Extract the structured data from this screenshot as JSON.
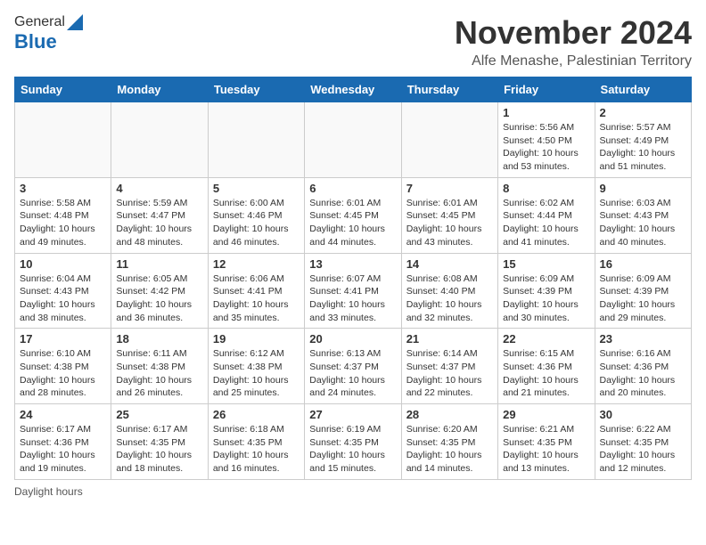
{
  "logo": {
    "general": "General",
    "blue": "Blue"
  },
  "header": {
    "month": "November 2024",
    "location": "Alfe Menashe, Palestinian Territory"
  },
  "weekdays": [
    "Sunday",
    "Monday",
    "Tuesday",
    "Wednesday",
    "Thursday",
    "Friday",
    "Saturday"
  ],
  "weeks": [
    [
      {
        "day": "",
        "info": ""
      },
      {
        "day": "",
        "info": ""
      },
      {
        "day": "",
        "info": ""
      },
      {
        "day": "",
        "info": ""
      },
      {
        "day": "",
        "info": ""
      },
      {
        "day": "1",
        "info": "Sunrise: 5:56 AM\nSunset: 4:50 PM\nDaylight: 10 hours\nand 53 minutes."
      },
      {
        "day": "2",
        "info": "Sunrise: 5:57 AM\nSunset: 4:49 PM\nDaylight: 10 hours\nand 51 minutes."
      }
    ],
    [
      {
        "day": "3",
        "info": "Sunrise: 5:58 AM\nSunset: 4:48 PM\nDaylight: 10 hours\nand 49 minutes."
      },
      {
        "day": "4",
        "info": "Sunrise: 5:59 AM\nSunset: 4:47 PM\nDaylight: 10 hours\nand 48 minutes."
      },
      {
        "day": "5",
        "info": "Sunrise: 6:00 AM\nSunset: 4:46 PM\nDaylight: 10 hours\nand 46 minutes."
      },
      {
        "day": "6",
        "info": "Sunrise: 6:01 AM\nSunset: 4:45 PM\nDaylight: 10 hours\nand 44 minutes."
      },
      {
        "day": "7",
        "info": "Sunrise: 6:01 AM\nSunset: 4:45 PM\nDaylight: 10 hours\nand 43 minutes."
      },
      {
        "day": "8",
        "info": "Sunrise: 6:02 AM\nSunset: 4:44 PM\nDaylight: 10 hours\nand 41 minutes."
      },
      {
        "day": "9",
        "info": "Sunrise: 6:03 AM\nSunset: 4:43 PM\nDaylight: 10 hours\nand 40 minutes."
      }
    ],
    [
      {
        "day": "10",
        "info": "Sunrise: 6:04 AM\nSunset: 4:43 PM\nDaylight: 10 hours\nand 38 minutes."
      },
      {
        "day": "11",
        "info": "Sunrise: 6:05 AM\nSunset: 4:42 PM\nDaylight: 10 hours\nand 36 minutes."
      },
      {
        "day": "12",
        "info": "Sunrise: 6:06 AM\nSunset: 4:41 PM\nDaylight: 10 hours\nand 35 minutes."
      },
      {
        "day": "13",
        "info": "Sunrise: 6:07 AM\nSunset: 4:41 PM\nDaylight: 10 hours\nand 33 minutes."
      },
      {
        "day": "14",
        "info": "Sunrise: 6:08 AM\nSunset: 4:40 PM\nDaylight: 10 hours\nand 32 minutes."
      },
      {
        "day": "15",
        "info": "Sunrise: 6:09 AM\nSunset: 4:39 PM\nDaylight: 10 hours\nand 30 minutes."
      },
      {
        "day": "16",
        "info": "Sunrise: 6:09 AM\nSunset: 4:39 PM\nDaylight: 10 hours\nand 29 minutes."
      }
    ],
    [
      {
        "day": "17",
        "info": "Sunrise: 6:10 AM\nSunset: 4:38 PM\nDaylight: 10 hours\nand 28 minutes."
      },
      {
        "day": "18",
        "info": "Sunrise: 6:11 AM\nSunset: 4:38 PM\nDaylight: 10 hours\nand 26 minutes."
      },
      {
        "day": "19",
        "info": "Sunrise: 6:12 AM\nSunset: 4:38 PM\nDaylight: 10 hours\nand 25 minutes."
      },
      {
        "day": "20",
        "info": "Sunrise: 6:13 AM\nSunset: 4:37 PM\nDaylight: 10 hours\nand 24 minutes."
      },
      {
        "day": "21",
        "info": "Sunrise: 6:14 AM\nSunset: 4:37 PM\nDaylight: 10 hours\nand 22 minutes."
      },
      {
        "day": "22",
        "info": "Sunrise: 6:15 AM\nSunset: 4:36 PM\nDaylight: 10 hours\nand 21 minutes."
      },
      {
        "day": "23",
        "info": "Sunrise: 6:16 AM\nSunset: 4:36 PM\nDaylight: 10 hours\nand 20 minutes."
      }
    ],
    [
      {
        "day": "24",
        "info": "Sunrise: 6:17 AM\nSunset: 4:36 PM\nDaylight: 10 hours\nand 19 minutes."
      },
      {
        "day": "25",
        "info": "Sunrise: 6:17 AM\nSunset: 4:35 PM\nDaylight: 10 hours\nand 18 minutes."
      },
      {
        "day": "26",
        "info": "Sunrise: 6:18 AM\nSunset: 4:35 PM\nDaylight: 10 hours\nand 16 minutes."
      },
      {
        "day": "27",
        "info": "Sunrise: 6:19 AM\nSunset: 4:35 PM\nDaylight: 10 hours\nand 15 minutes."
      },
      {
        "day": "28",
        "info": "Sunrise: 6:20 AM\nSunset: 4:35 PM\nDaylight: 10 hours\nand 14 minutes."
      },
      {
        "day": "29",
        "info": "Sunrise: 6:21 AM\nSunset: 4:35 PM\nDaylight: 10 hours\nand 13 minutes."
      },
      {
        "day": "30",
        "info": "Sunrise: 6:22 AM\nSunset: 4:35 PM\nDaylight: 10 hours\nand 12 minutes."
      }
    ]
  ],
  "footer": {
    "note": "Daylight hours"
  }
}
